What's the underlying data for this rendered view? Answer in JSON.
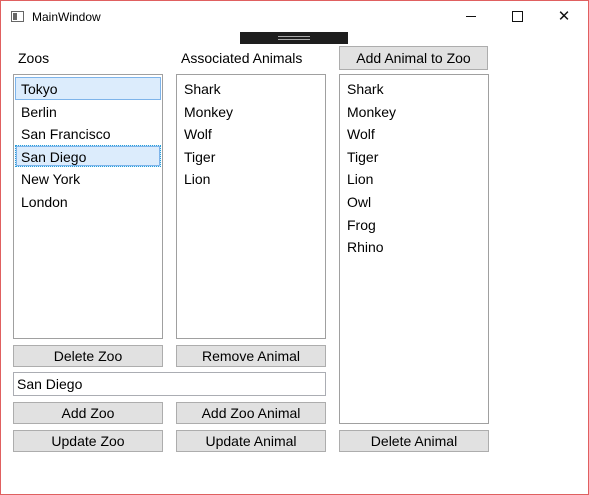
{
  "window": {
    "title": "MainWindow"
  },
  "zoos": {
    "label": "Zoos",
    "items": [
      "Tokyo",
      "Berlin",
      "San Francisco",
      "San Diego",
      "New York",
      "London"
    ],
    "selected_hover": "Tokyo",
    "selected": "San Diego"
  },
  "associated": {
    "label": "Associated Animals",
    "items": [
      "Shark",
      "Monkey",
      "Wolf",
      "Tiger",
      "Lion"
    ]
  },
  "animals": {
    "items": [
      "Shark",
      "Monkey",
      "Wolf",
      "Tiger",
      "Lion",
      "Owl",
      "Frog",
      "Rhino"
    ]
  },
  "buttons": {
    "add_animal_to_zoo": "Add Animal to Zoo",
    "delete_zoo": "Delete Zoo",
    "remove_animal": "Remove Animal",
    "add_zoo": "Add Zoo",
    "add_zoo_animal": "Add Zoo Animal",
    "update_zoo": "Update Zoo",
    "update_animal": "Update Animal",
    "delete_animal": "Delete Animal"
  },
  "input": {
    "value": "San Diego"
  }
}
